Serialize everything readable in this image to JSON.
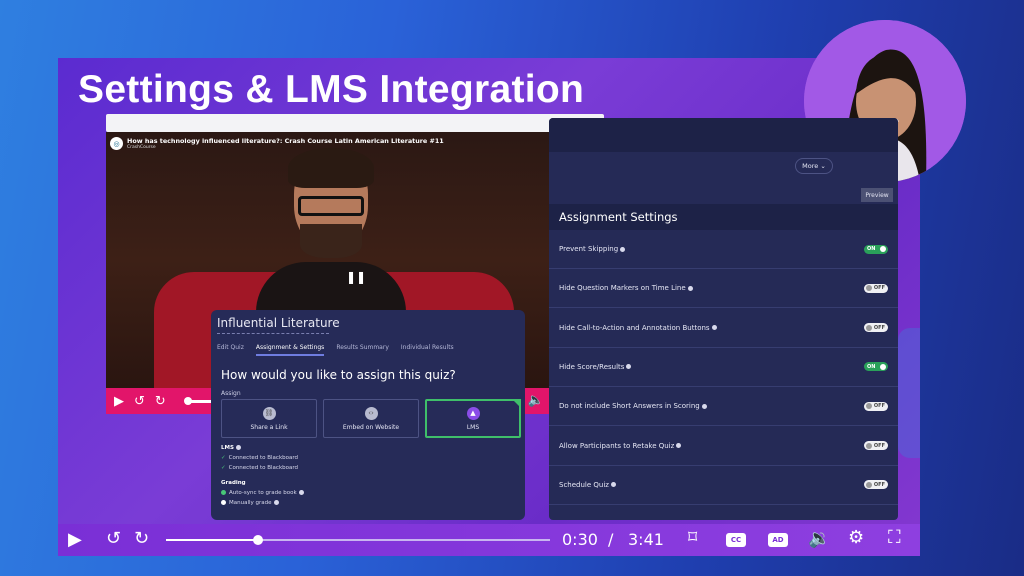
{
  "headline": "Settings & LMS Integration",
  "video": {
    "title": "How has technology influenced literature?: Crash Course Latin American Literature #11",
    "channel": "CrashCourse"
  },
  "quiz": {
    "title": "Influential Literature",
    "tabs": [
      "Edit Quiz",
      "Assignment & Settings",
      "Results Summary",
      "Individual Results"
    ],
    "question": "How would you like to assign this quiz?",
    "assign_label": "Assign",
    "options": [
      "Share a Link",
      "Embed on Website",
      "LMS"
    ],
    "lms_head": "LMS",
    "lms_items": [
      "Connected to Blackboard",
      "Connected to Blackboard"
    ],
    "grading_head": "Grading",
    "grading_items": [
      "Auto-sync to grade book",
      "Manually grade"
    ]
  },
  "settings": {
    "more_label": "More",
    "preview_label": "Preview",
    "heading": "Assignment Settings",
    "rows": [
      {
        "label": "Prevent Skipping",
        "state": "ON"
      },
      {
        "label": "Hide Question Markers on Time Line",
        "state": "OFF"
      },
      {
        "label": "Hide Call-to-Action and Annotation Buttons",
        "state": "OFF"
      },
      {
        "label": "Hide Score/Results",
        "state": "ON"
      },
      {
        "label": "Do not include Short Answers in Scoring",
        "state": "OFF"
      },
      {
        "label": "Allow Participants to Retake Quiz",
        "state": "OFF"
      },
      {
        "label": "Schedule Quiz",
        "state": "OFF"
      }
    ]
  },
  "player": {
    "current_time": "0:30",
    "separator": "/",
    "duration": "3:41",
    "cc_label": "CC",
    "ad_label": "AD"
  }
}
